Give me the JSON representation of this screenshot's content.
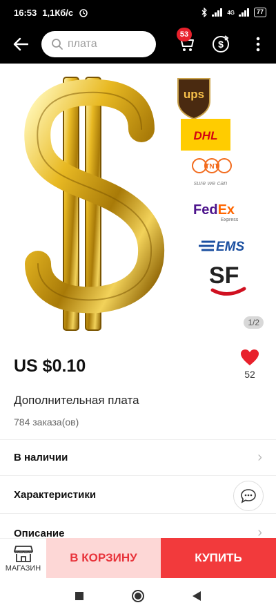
{
  "status_bar": {
    "time": "16:53",
    "speed": "1,1Кб/с",
    "network": "4G",
    "battery": "77"
  },
  "header": {
    "search_placeholder": "плата",
    "cart_count": "53"
  },
  "gallery": {
    "counter": "1/2",
    "carrier_logos": [
      "UPS",
      "DHL",
      "TNT",
      "sure we can",
      "FedEx",
      "Express",
      "EMS",
      "SF"
    ]
  },
  "product": {
    "price": "US $0.10",
    "wishlist_count": "52",
    "title": "Дополнительная плата",
    "orders": "784 заказа(ов)"
  },
  "sections": {
    "availability": "В наличии",
    "specs": "Характеристики",
    "description": "Описание"
  },
  "actions": {
    "store": "МАГАЗИН",
    "add_to_cart": "В КОРЗИНУ",
    "buy": "КУПИТЬ"
  },
  "colors": {
    "accent_red": "#f23a3c",
    "cart_button_bg": "#fdd7d6",
    "badge_red": "#e8212c"
  }
}
